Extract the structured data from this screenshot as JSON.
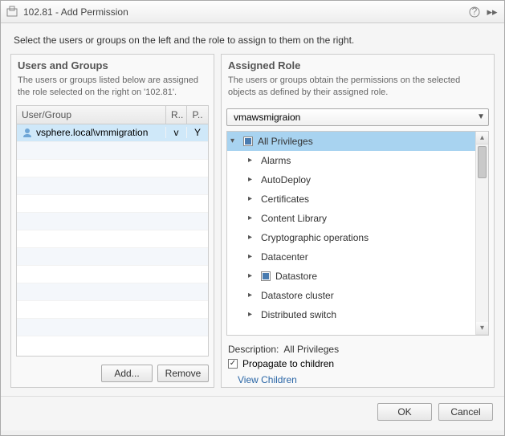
{
  "window": {
    "title": "102.81 - Add Permission"
  },
  "intro": "Select the users or groups on the left and the role to assign to them on the right.",
  "left": {
    "title": "Users and Groups",
    "desc": "The users or groups listed below are assigned the role selected on the right on '102.81'.",
    "columns": {
      "usergroup": "User/Group",
      "r": "R..",
      "p": "P.."
    },
    "rows": [
      {
        "name": "vsphere.local\\vmmigration",
        "r": "v",
        "p": "Y"
      }
    ],
    "add": "Add...",
    "remove": "Remove"
  },
  "right": {
    "title": "Assigned Role",
    "desc": "The users or groups obtain the permissions on the selected objects as defined by their assigned role.",
    "role": "vmawsmigraion",
    "tree": {
      "root": "All Privileges",
      "children": [
        {
          "label": "Alarms",
          "checked": false
        },
        {
          "label": "AutoDeploy",
          "checked": false
        },
        {
          "label": "Certificates",
          "checked": false
        },
        {
          "label": "Content Library",
          "checked": false
        },
        {
          "label": "Cryptographic operations",
          "checked": false
        },
        {
          "label": "Datacenter",
          "checked": false
        },
        {
          "label": "Datastore",
          "checked": true
        },
        {
          "label": "Datastore cluster",
          "checked": false
        },
        {
          "label": "Distributed switch",
          "checked": false
        }
      ]
    },
    "description_label": "Description:",
    "description_value": "All Privileges",
    "propagate": "Propagate to children",
    "view_children": "View Children"
  },
  "footer": {
    "ok": "OK",
    "cancel": "Cancel"
  }
}
